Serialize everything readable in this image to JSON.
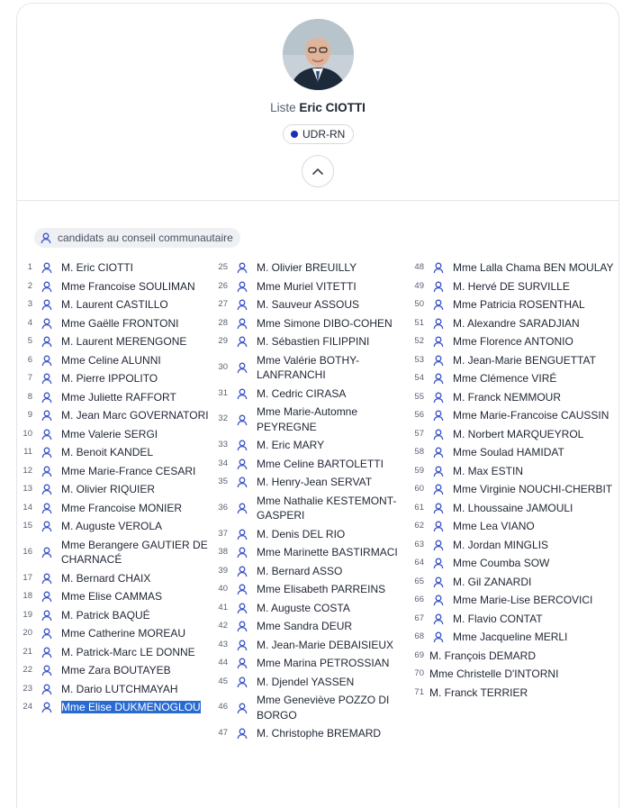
{
  "header": {
    "liste_prefix": "Liste",
    "liste_name": "Eric CIOTTI",
    "party": "UDR-RN",
    "party_color": "#1a2fb5"
  },
  "section": {
    "label": "candidats au conseil communautaire"
  },
  "icons": {
    "candidate": "user-icon",
    "collapse": "chevron-up-icon"
  },
  "columns": [
    [
      {
        "num": "1",
        "name": "M. Eric CIOTTI"
      },
      {
        "num": "2",
        "name": "Mme Francoise SOULIMAN"
      },
      {
        "num": "3",
        "name": "M. Laurent CASTILLO"
      },
      {
        "num": "4",
        "name": "Mme Gaëlle FRONTONI"
      },
      {
        "num": "5",
        "name": "M. Laurent MERENGONE"
      },
      {
        "num": "6",
        "name": "Mme Celine ALUNNI"
      },
      {
        "num": "7",
        "name": "M. Pierre IPPOLITO"
      },
      {
        "num": "8",
        "name": "Mme Juliette RAFFORT"
      },
      {
        "num": "9",
        "name": "M. Jean Marc GOVERNATORI"
      },
      {
        "num": "10",
        "name": "Mme Valerie SERGI"
      },
      {
        "num": "11",
        "name": "M. Benoit KANDEL"
      },
      {
        "num": "12",
        "name": "Mme Marie-France CESARI"
      },
      {
        "num": "13",
        "name": "M. Olivier RIQUIER"
      },
      {
        "num": "14",
        "name": "Mme Francoise MONIER"
      },
      {
        "num": "15",
        "name": "M. Auguste VEROLA"
      },
      {
        "num": "16",
        "name": "Mme Berangere GAUTIER DE CHARNACÉ"
      },
      {
        "num": "17",
        "name": "M. Bernard CHAIX"
      },
      {
        "num": "18",
        "name": "Mme Elise CAMMAS"
      },
      {
        "num": "19",
        "name": "M. Patrick BAQUÉ"
      },
      {
        "num": "20",
        "name": "Mme Catherine MOREAU"
      },
      {
        "num": "21",
        "name": "M. Patrick-Marc LE DONNE"
      },
      {
        "num": "22",
        "name": "Mme Zara BOUTAYEB"
      },
      {
        "num": "23",
        "name": "M. Dario LUTCHMAYAH"
      },
      {
        "num": "24",
        "name": "Mme Elise DUKMENOGLOU",
        "selected": true
      }
    ],
    [
      {
        "num": "25",
        "name": "M. Olivier BREUILLY"
      },
      {
        "num": "26",
        "name": "Mme Muriel VITETTI"
      },
      {
        "num": "27",
        "name": "M. Sauveur ASSOUS"
      },
      {
        "num": "28",
        "name": "Mme Simone DIBO-COHEN"
      },
      {
        "num": "29",
        "name": "M. Sébastien FILIPPINI"
      },
      {
        "num": "30",
        "name": "Mme Valérie BOTHY-LANFRANCHI"
      },
      {
        "num": "31",
        "name": "M. Cedric CIRASA"
      },
      {
        "num": "32",
        "name": "Mme Marie-Automne PEYREGNE"
      },
      {
        "num": "33",
        "name": "M. Eric MARY"
      },
      {
        "num": "34",
        "name": "Mme Celine BARTOLETTI"
      },
      {
        "num": "35",
        "name": "M. Henry-Jean SERVAT"
      },
      {
        "num": "36",
        "name": "Mme Nathalie KESTEMONT-GASPERI"
      },
      {
        "num": "37",
        "name": "M. Denis DEL RIO"
      },
      {
        "num": "38",
        "name": "Mme Marinette BASTIRMACI"
      },
      {
        "num": "39",
        "name": "M. Bernard ASSO"
      },
      {
        "num": "40",
        "name": "Mme Elisabeth PARREINS"
      },
      {
        "num": "41",
        "name": "M. Auguste COSTA"
      },
      {
        "num": "42",
        "name": "Mme Sandra DEUR"
      },
      {
        "num": "43",
        "name": "M. Jean-Marie DEBAISIEUX"
      },
      {
        "num": "44",
        "name": "Mme Marina PETROSSIAN"
      },
      {
        "num": "45",
        "name": "M. Djendel YASSEN"
      },
      {
        "num": "46",
        "name": "Mme Geneviève POZZO DI BORGO"
      },
      {
        "num": "47",
        "name": "M. Christophe BREMARD"
      }
    ],
    [
      {
        "num": "48",
        "name": "Mme Lalla Chama BEN MOULAY"
      },
      {
        "num": "49",
        "name": "M. Hervé DE SURVILLE"
      },
      {
        "num": "50",
        "name": "Mme Patricia ROSENTHAL"
      },
      {
        "num": "51",
        "name": "M. Alexandre SARADJIAN"
      },
      {
        "num": "52",
        "name": "Mme Florence ANTONIO"
      },
      {
        "num": "53",
        "name": "M. Jean-Marie BENGUETTAT"
      },
      {
        "num": "54",
        "name": "Mme Clémence VIRÉ"
      },
      {
        "num": "55",
        "name": "M. Franck NEMMOUR"
      },
      {
        "num": "56",
        "name": "Mme Marie-Francoise CAUSSIN"
      },
      {
        "num": "57",
        "name": "M. Norbert MARQUEYROL"
      },
      {
        "num": "58",
        "name": "Mme Soulad HAMIDAT"
      },
      {
        "num": "59",
        "name": "M. Max ESTIN"
      },
      {
        "num": "60",
        "name": "Mme Virginie NOUCHI-CHERBIT"
      },
      {
        "num": "61",
        "name": "M. Lhoussaine JAMOULI"
      },
      {
        "num": "62",
        "name": "Mme Lea VIANO"
      },
      {
        "num": "63",
        "name": "M. Jordan MINGLIS"
      },
      {
        "num": "64",
        "name": "Mme Coumba SOW"
      },
      {
        "num": "65",
        "name": "M. Gil ZANARDI"
      },
      {
        "num": "66",
        "name": "Mme Marie-Lise BERCOVICI"
      },
      {
        "num": "67",
        "name": "M. Flavio CONTAT"
      },
      {
        "num": "68",
        "name": "Mme Jacqueline MERLI"
      },
      {
        "num": "69",
        "name": "M. François DEMARD",
        "noicon": true
      },
      {
        "num": "70",
        "name": "Mme Christelle D'INTORNI",
        "noicon": true
      },
      {
        "num": "71",
        "name": "M. Franck TERRIER",
        "noicon": true
      }
    ]
  ]
}
